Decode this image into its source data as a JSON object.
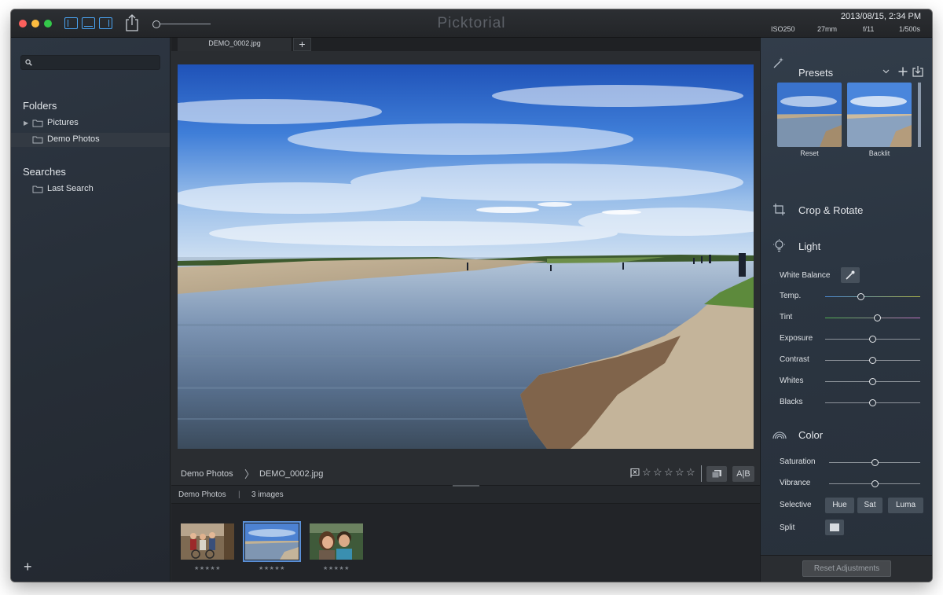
{
  "app": {
    "title": "Picktorial"
  },
  "exif": {
    "date": "2013/08/15, 2:34 PM",
    "iso": "ISO250",
    "focal": "27mm",
    "aperture": "f/11",
    "shutter": "1/500s"
  },
  "sidebar": {
    "search_placeholder": "",
    "folders_heading": "Folders",
    "folders": [
      {
        "label": "Pictures",
        "expandable": true
      },
      {
        "label": "Demo Photos",
        "selected": true
      }
    ],
    "searches_heading": "Searches",
    "searches": [
      {
        "label": "Last Search"
      }
    ],
    "add_label": "+"
  },
  "tabs": {
    "items": [
      {
        "label": "DEMO_0002.jpg"
      }
    ],
    "add_label": "+"
  },
  "viewer": {
    "breadcrumb_folder": "Demo Photos",
    "breadcrumb_sep": "〉",
    "breadcrumb_file": "DEMO_0002.jpg",
    "rating": 0,
    "max_rating": 5,
    "star_glyph": "☆",
    "compare_label": "A|B"
  },
  "filmstrip": {
    "folder": "Demo Photos",
    "separator": "|",
    "count": "3 images",
    "thumb_stars": "★★★★★",
    "thumbnails": [
      {
        "name": "group-photo-thumb"
      },
      {
        "name": "beach-photo-thumb",
        "selected": true
      },
      {
        "name": "couple-photo-thumb"
      }
    ]
  },
  "right_panel": {
    "presets_heading": "Presets",
    "presets": [
      {
        "label": "Reset"
      },
      {
        "label": "Backlit"
      }
    ],
    "crop_heading": "Crop & Rotate",
    "light_heading": "Light",
    "white_balance_label": "White Balance",
    "light_sliders": [
      {
        "label": "Temp.",
        "value": 0.38
      },
      {
        "label": "Tint",
        "value": 0.55
      },
      {
        "label": "Exposure",
        "value": 0.5
      },
      {
        "label": "Contrast",
        "value": 0.5
      },
      {
        "label": "Whites",
        "value": 0.5
      },
      {
        "label": "Blacks",
        "value": 0.5
      }
    ],
    "color_heading": "Color",
    "color_sliders": [
      {
        "label": "Saturation",
        "value": 0.5
      },
      {
        "label": "Vibrance",
        "value": 0.5
      }
    ],
    "selective_label": "Selective",
    "selective_buttons": [
      "Hue",
      "Sat",
      "Luma"
    ],
    "split_label": "Split",
    "reset_label": "Reset Adjustments"
  },
  "colors": {
    "accent": "#4aa3f0",
    "selection_outline": "#5a8fd6"
  }
}
